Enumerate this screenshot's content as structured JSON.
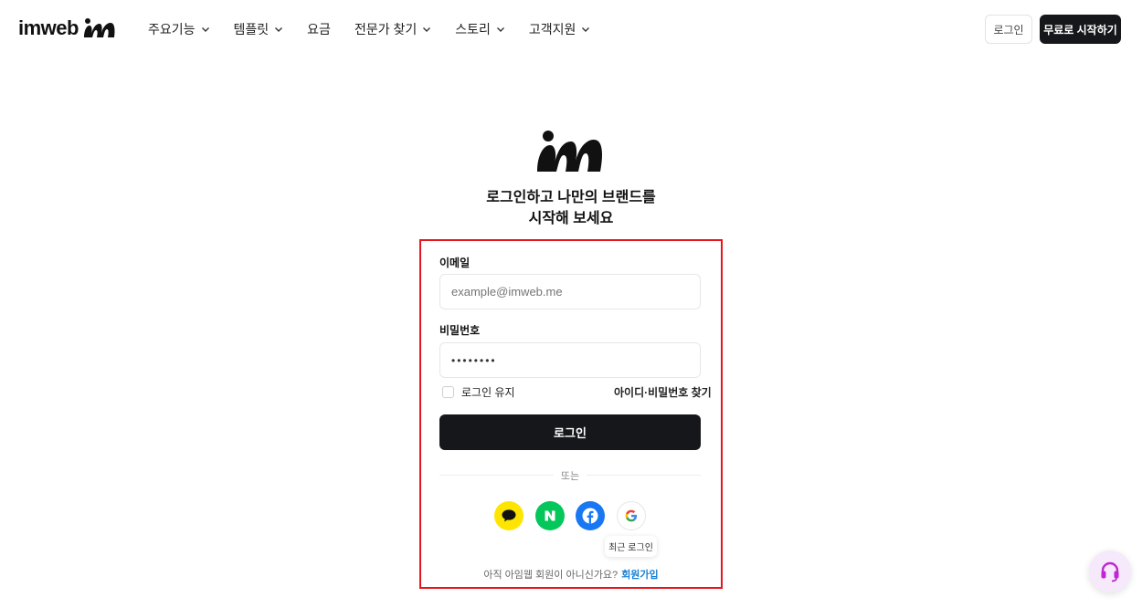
{
  "header": {
    "logo_text": "imweb",
    "nav": [
      {
        "label": "주요기능",
        "has_dropdown": true
      },
      {
        "label": "템플릿",
        "has_dropdown": true
      },
      {
        "label": "요금",
        "has_dropdown": false
      },
      {
        "label": "전문가 찾기",
        "has_dropdown": true
      },
      {
        "label": "스토리",
        "has_dropdown": true
      },
      {
        "label": "고객지원",
        "has_dropdown": true
      }
    ],
    "login_label": "로그인",
    "start_label": "무료로 시작하기"
  },
  "hero": {
    "line1": "로그인하고 나만의 브랜드를",
    "line2": "시작해 보세요"
  },
  "form": {
    "email_label": "이메일",
    "email_placeholder": "example@imweb.me",
    "password_label": "비밀번호",
    "password_value": "••••••••",
    "remember_label": "로그인 유지",
    "find_label": "아이디·비밀번호 찾기",
    "login_button": "로그인",
    "or_label": "또는",
    "social": [
      {
        "name": "kakao-icon",
        "color": "#fee500"
      },
      {
        "name": "naver-icon",
        "color": "#03c75a"
      },
      {
        "name": "facebook-icon",
        "color": "#1877f2"
      },
      {
        "name": "google-icon",
        "color": "#ffffff"
      }
    ],
    "recent_login_label": "최근 로그인",
    "signup_prompt": "아직 아임웹 회원이 아니신가요?",
    "signup_link": "회원가입"
  },
  "colors": {
    "primary_dark": "#16171a",
    "highlight_border": "#e5171c",
    "link": "#1a7fd4"
  }
}
